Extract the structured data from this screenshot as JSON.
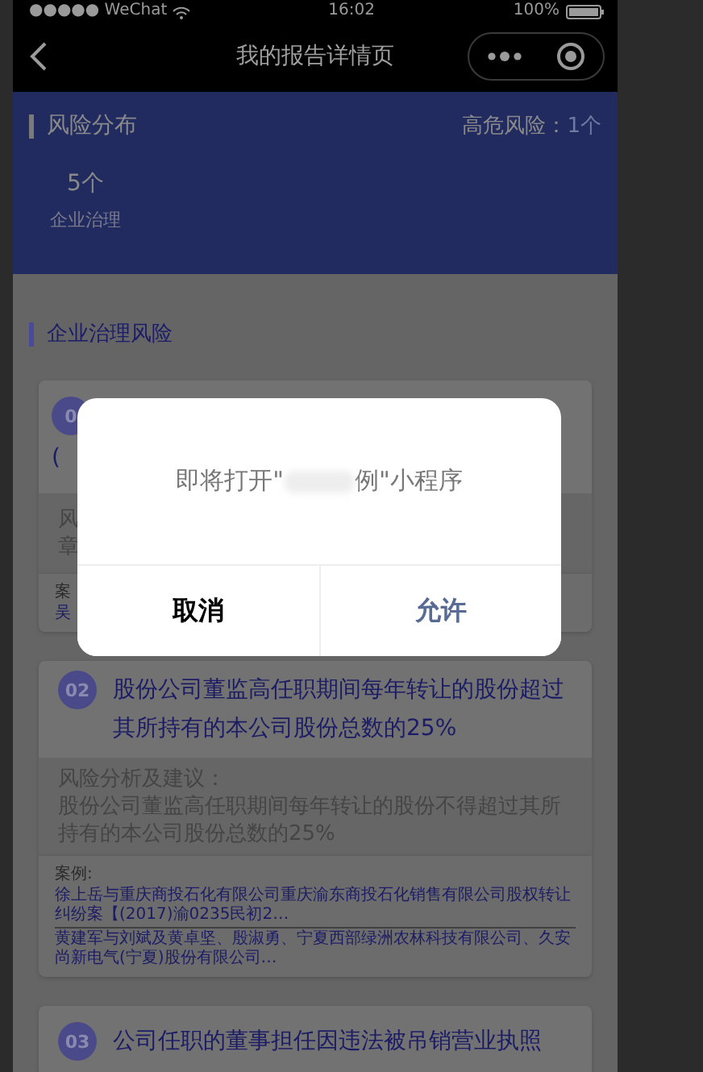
{
  "status_bar": {
    "carrier": "●●●●● WeChat",
    "time": "16:02",
    "battery": "100%"
  },
  "nav": {
    "title": "我的报告详情页"
  },
  "distribution": {
    "title": "风险分布",
    "high_risk_label": "高危风险：",
    "high_risk_value": "1个",
    "items": [
      {
        "count": "5个",
        "label": "企业治理"
      }
    ]
  },
  "section": {
    "title": "企业治理风险"
  },
  "cards": [
    {
      "badge": "0",
      "title_lines": [
        "("
      ],
      "advice_lines": [
        "风",
        "章"
      ],
      "case_label": "案",
      "case_links": [
        "吴"
      ]
    },
    {
      "badge": "02",
      "title_lines": [
        "股份公司董监高任职期间每年转让的股份超过其所持有的本公司股份总数的25%"
      ],
      "advice_lines": [
        "风险分析及建议：",
        "股份公司董监高任职期间每年转让的股份不得超过其所持有的本公司股份总数的25%"
      ],
      "case_label": "案例:",
      "case_links": [
        "徐上岳与重庆商投石化有限公司重庆渝东商投石化销售有限公司股权转让纠纷案【(2017)渝0235民初2…",
        "黄建军与刘斌及黄卓坚、殷淑勇、宁夏西部绿洲农林科技有限公司、久安尚新电气(宁夏)股份有限公司…"
      ]
    },
    {
      "badge": "03",
      "title_lines": [
        "公司任职的董事担任因违法被吊销营业执照"
      ]
    }
  ],
  "dialog": {
    "message_before": "即将打开\"",
    "message_after": "例\"小程序",
    "buttons": [
      {
        "label": "取消",
        "kind": "cancel"
      },
      {
        "label": "允许",
        "kind": "confirm"
      }
    ]
  }
}
